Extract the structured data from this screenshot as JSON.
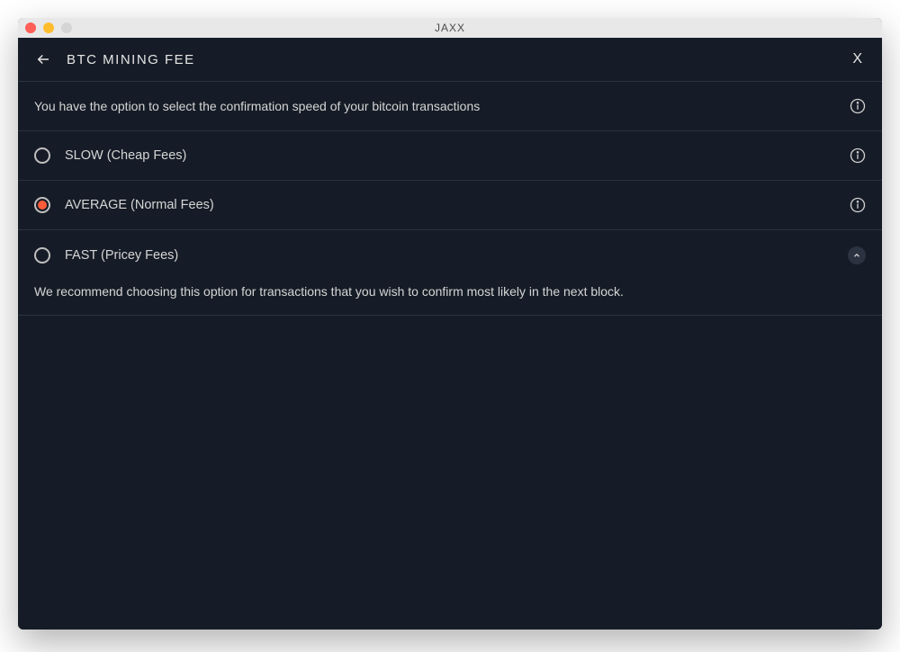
{
  "window": {
    "title": "JAXX"
  },
  "header": {
    "title": "BTC MINING FEE",
    "close_label": "X"
  },
  "intro": {
    "text": "You have the option to select the confirmation speed of your bitcoin transactions"
  },
  "options": [
    {
      "label": "SLOW (Cheap Fees)",
      "selected": false,
      "expanded": false
    },
    {
      "label": "AVERAGE (Normal Fees)",
      "selected": true,
      "expanded": false
    },
    {
      "label": "FAST (Pricey Fees)",
      "selected": false,
      "expanded": true,
      "description": "We recommend choosing this option for transactions that you wish to confirm most likely in the next block."
    }
  ]
}
